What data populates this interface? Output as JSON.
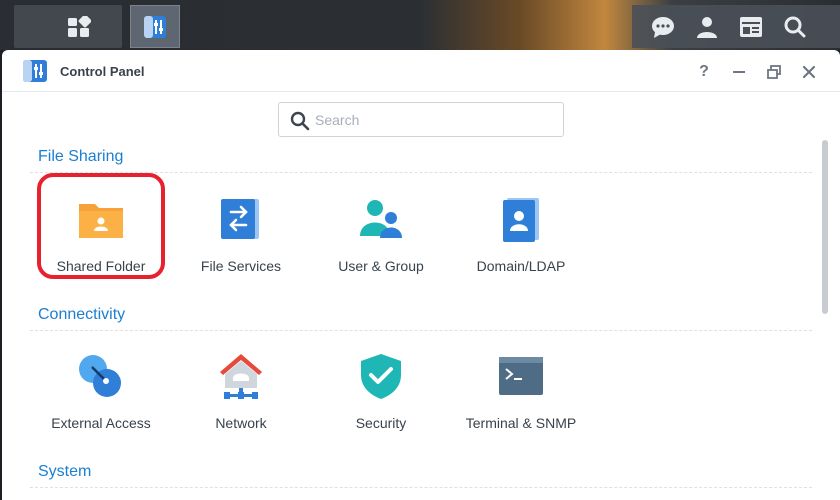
{
  "window": {
    "title": "Control Panel"
  },
  "search": {
    "placeholder": "Search"
  },
  "sections": [
    {
      "title": "File Sharing",
      "items": [
        {
          "label": "Shared Folder",
          "icon": "shared-folder-icon"
        },
        {
          "label": "File Services",
          "icon": "file-services-icon"
        },
        {
          "label": "User & Group",
          "icon": "user-group-icon"
        },
        {
          "label": "Domain/LDAP",
          "icon": "domain-ldap-icon"
        }
      ]
    },
    {
      "title": "Connectivity",
      "items": [
        {
          "label": "External Access",
          "icon": "external-access-icon"
        },
        {
          "label": "Network",
          "icon": "network-icon"
        },
        {
          "label": "Security",
          "icon": "security-icon"
        },
        {
          "label": "Terminal & SNMP",
          "icon": "terminal-icon"
        }
      ]
    },
    {
      "title": "System",
      "items": []
    }
  ],
  "titlebar": {
    "help": "?",
    "minimize": "—",
    "close": "✕"
  },
  "colors": {
    "section_title": "#1b7fd1",
    "highlight": "#e8212e",
    "accent": "#2f7ed8"
  }
}
